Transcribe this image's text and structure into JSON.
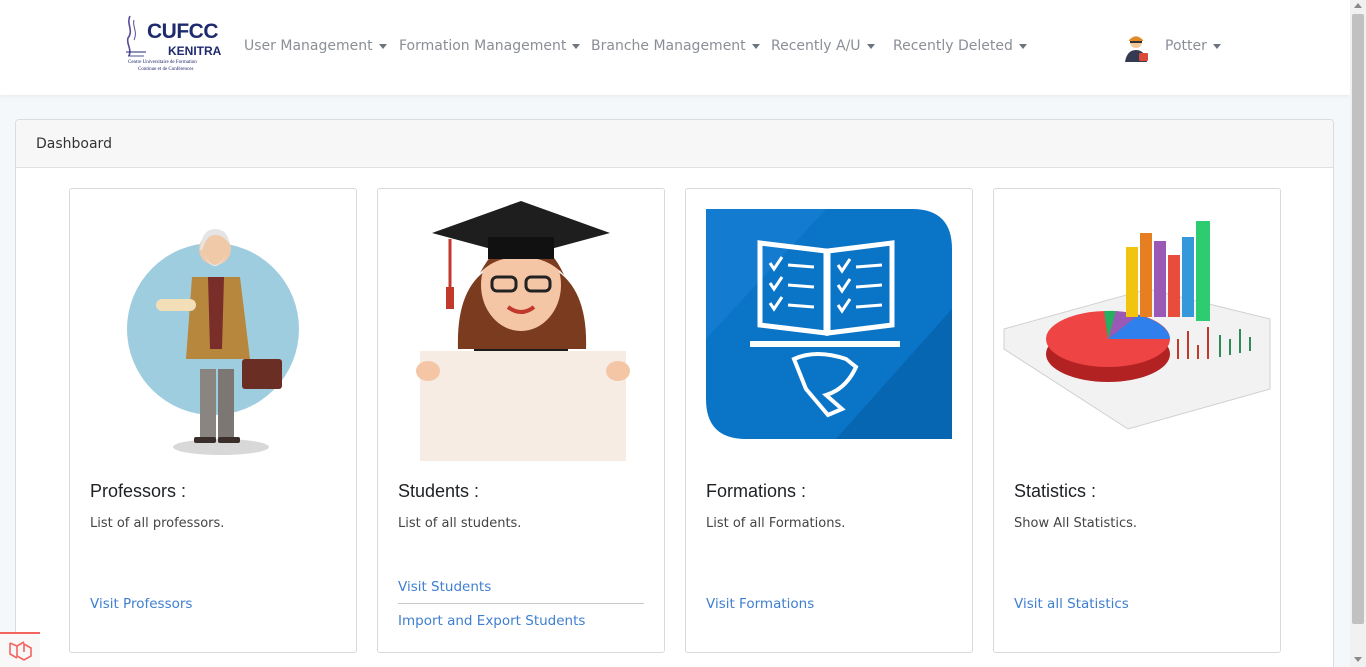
{
  "brand": {
    "main": "CUFCC",
    "sub": "KENITRA",
    "line1": "Centre Universitaire de Formation",
    "line2": "Continue et de Conférences"
  },
  "nav": {
    "items": [
      {
        "label": "User Management"
      },
      {
        "label": "Formation Management"
      },
      {
        "label": "Branche Management"
      },
      {
        "label": "Recently A/U"
      },
      {
        "label": "Recently Deleted"
      }
    ],
    "user": {
      "name": "Potter"
    }
  },
  "panel": {
    "title": "Dashboard"
  },
  "cards": [
    {
      "title": "Professors :",
      "text": "List of all professors.",
      "links": [
        "Visit Professors"
      ]
    },
    {
      "title": "Students :",
      "text": "List of all students.",
      "links": [
        "Visit Students",
        "Import and Export Students"
      ]
    },
    {
      "title": "Formations :",
      "text": "List of all Formations.",
      "links": [
        "Visit Formations"
      ]
    },
    {
      "title": "Statistics :",
      "text": "Show All Statistics.",
      "links": [
        "Visit all Statistics"
      ]
    }
  ],
  "icons": {
    "brand": "cufcc-logo",
    "user": "user-avatar-icon",
    "professors": "professor-illustration",
    "students": "graduate-student-illustration",
    "formations": "book-checklist-icon",
    "statistics": "statistics-charts-illustration",
    "debugbar": "laravel-icon"
  },
  "colors": {
    "link": "#3f7fd1",
    "nav_text": "#8a8f96",
    "brand": "#1f2a6e",
    "formation_blue": "#0a74c7",
    "background": "#f5f8fa"
  }
}
